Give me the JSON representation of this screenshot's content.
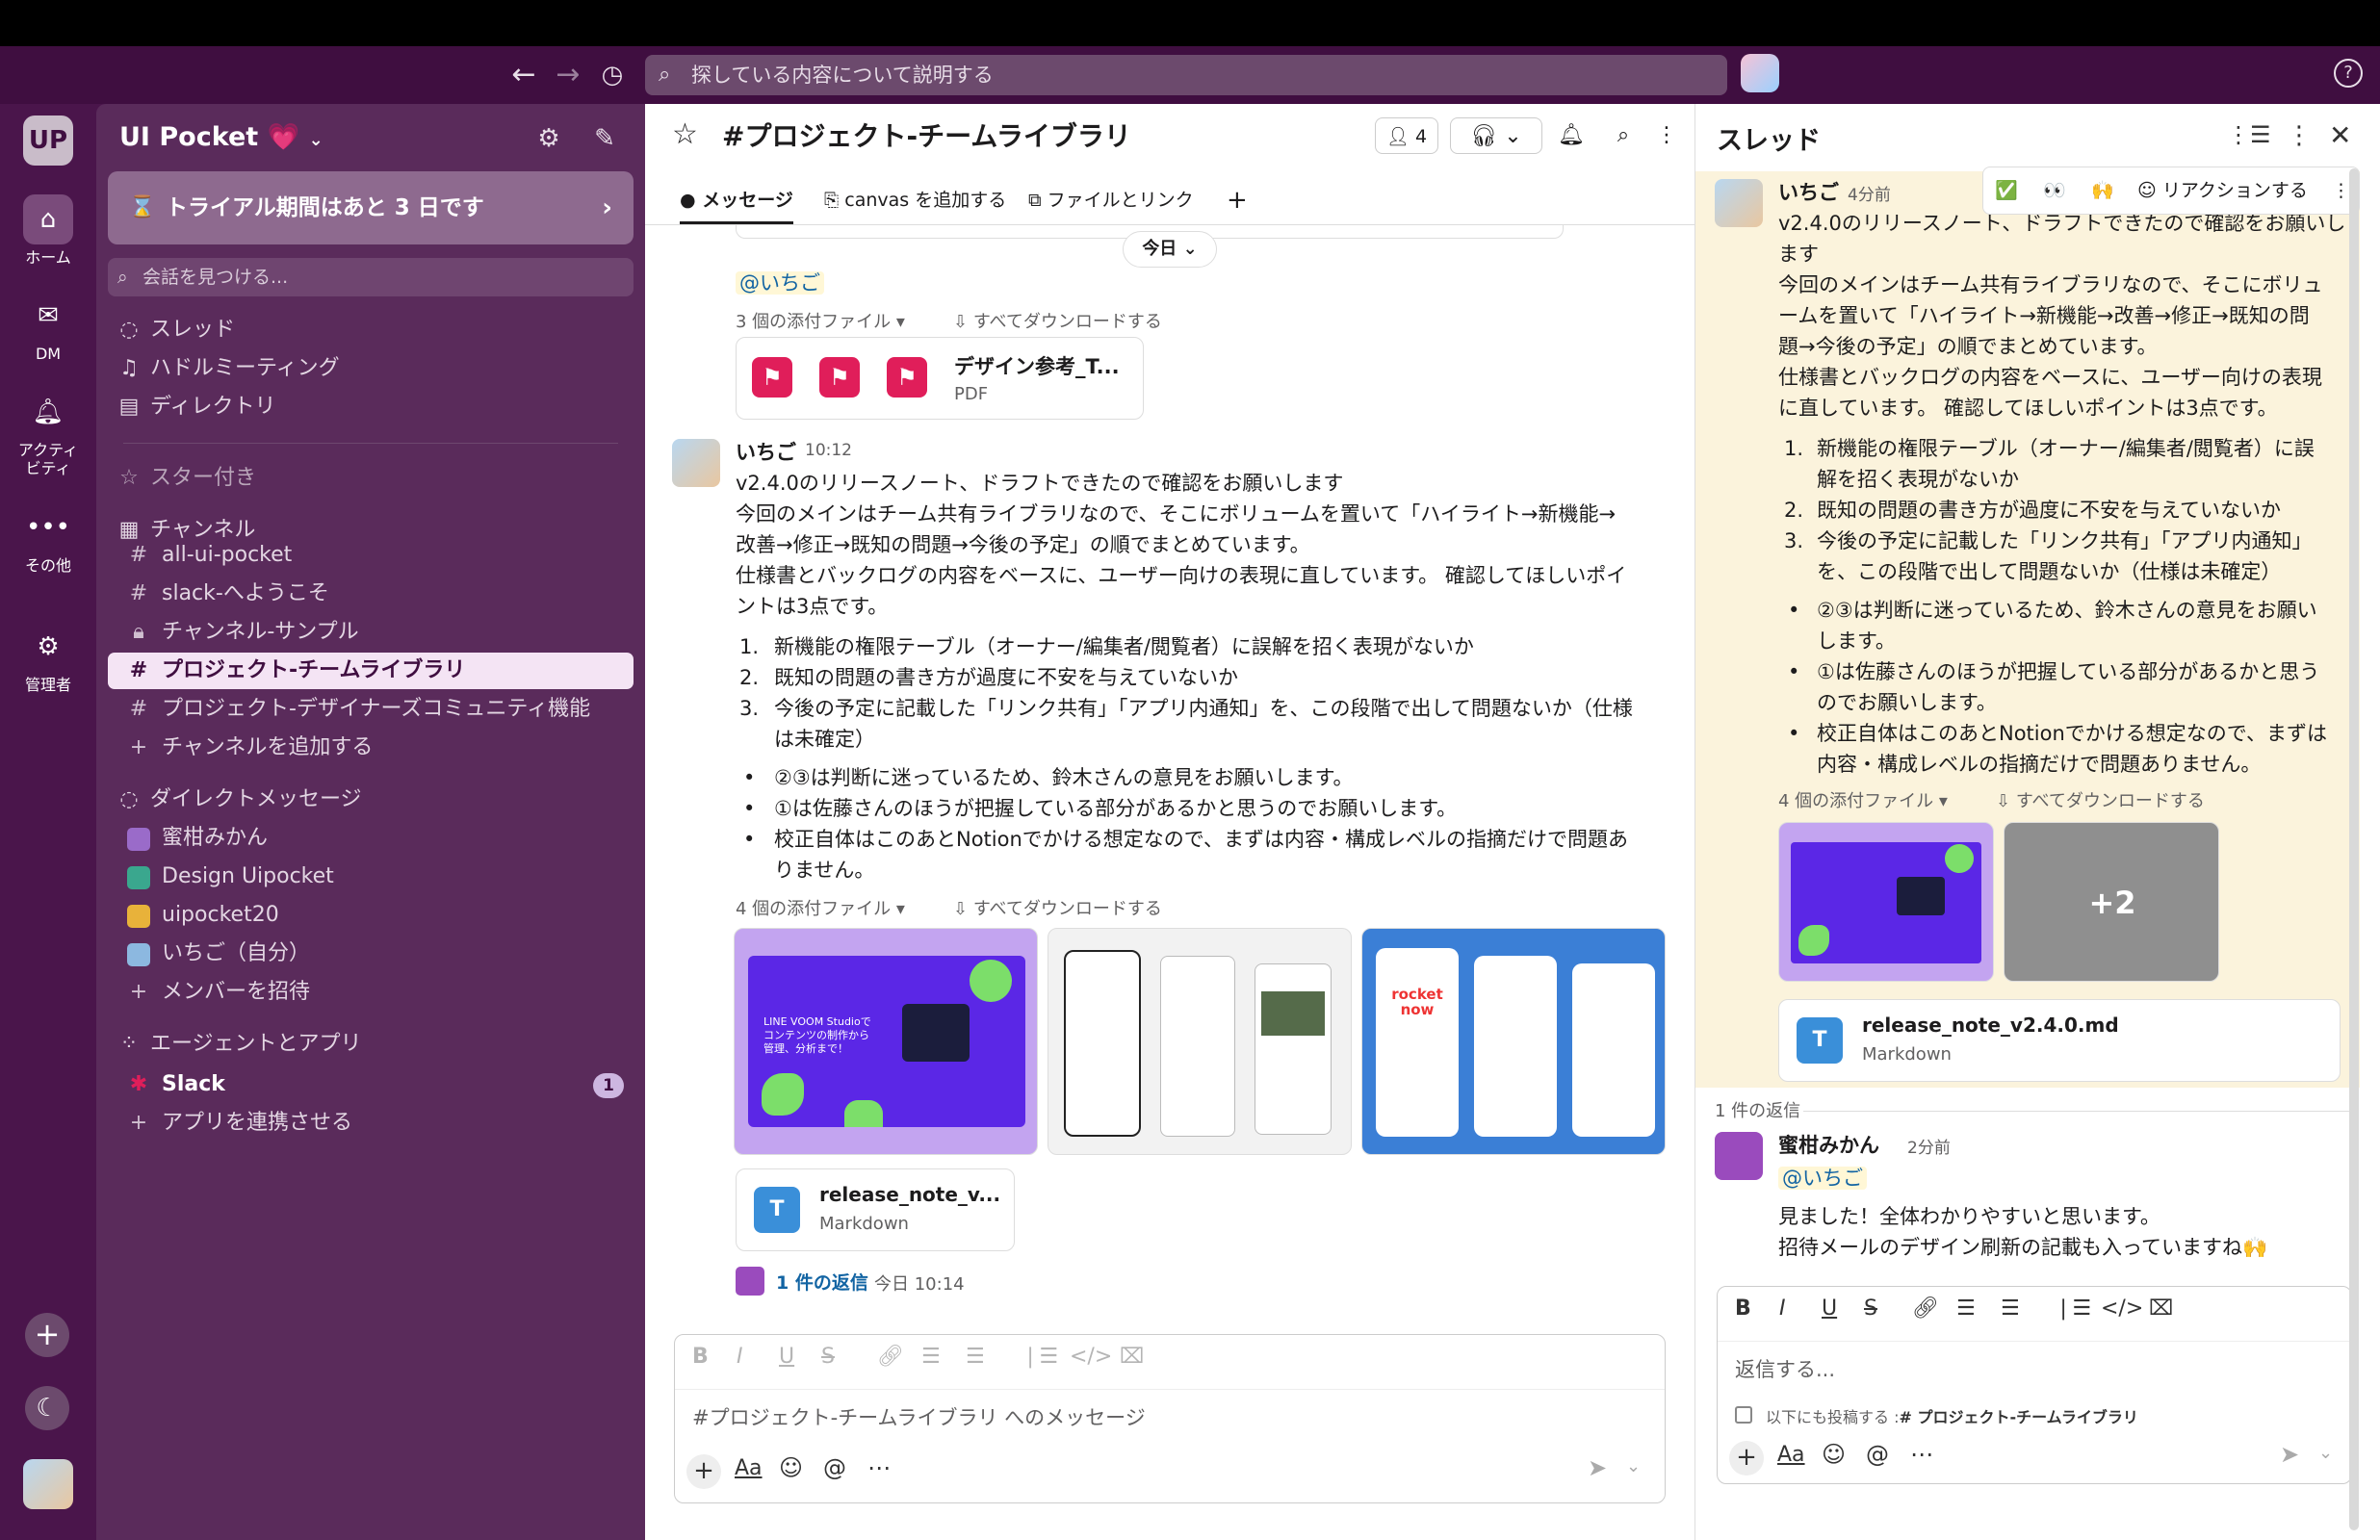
{
  "topbar": {
    "search_placeholder": "探している内容について説明する"
  },
  "rail": {
    "workspace": "UP",
    "home": "ホーム",
    "dm": "DM",
    "activity1": "アクティ",
    "activity2": "ビティ",
    "more": "その他",
    "admin": "管理者"
  },
  "sidebar": {
    "workspace_name": "UI Pocket 💗",
    "trial": "トライアル期間はあと 3 日です",
    "find": "会話を見つける...",
    "nav": [
      "スレッド",
      "ハドルミーティング",
      "ディレクトリ"
    ],
    "starred": "スター付き",
    "channels_header": "チャンネル",
    "channels": [
      "all-ui-pocket",
      "slack-へようこそ",
      "チャンネル-サンプル",
      "プロジェクト-チームライブラリ",
      "プロジェクト-デザイナーズコミュニティ機能"
    ],
    "add_channel": "チャンネルを追加する",
    "dm_header": "ダイレクトメッセージ",
    "dms": [
      "蜜柑みかん",
      "Design Uipocket",
      "uipocket20",
      "いちご（自分）"
    ],
    "invite": "メンバーを招待",
    "apps_header": "エージェントとアプリ",
    "slack": "Slack",
    "slack_badge": "1",
    "connect_app": "アプリを連携させる"
  },
  "channel": {
    "title": "#プロジェクト-チームライブラリ",
    "members": "4",
    "tabs": [
      "メッセージ",
      "canvas を追加する",
      "ファイルとリンク"
    ],
    "date_divider": "今日",
    "mention": "@いちご",
    "attach3": "3 個の添付ファイル",
    "download_all": "すべてダウンロードする",
    "pdf_name": "デザイン参考_T...",
    "pdf_type": "PDF",
    "author": "いちご",
    "time": "10:12",
    "para1": "v2.4.0のリリースノート、ドラフトできたので確認をお願いします",
    "para2a": "今回のメインはチーム共有ライブラリなので、そこにボリュームを置いて「ハイライト→新機能→",
    "para2b": "改善→修正→既知の問題→今後の予定」の順でまとめています。",
    "para3a": "仕様書とバックログの内容をベースに、ユーザー向けの表現に直しています。 確認してほしいポイ",
    "para3b": "ントは3点です。",
    "ol1": "新機能の権限テーブル（オーナー/編集者/閲覧者）に誤解を招く表現がないか",
    "ol2": "既知の問題の書き方が過度に不安を与えていないか",
    "ol3a": "今後の予定に記載した「リンク共有」「アプリ内通知」を、この段階で出して問題ないか（仕様",
    "ol3b": "は未確定）",
    "ul1": "②③は判断に迷っているため、鈴木さんの意見をお願いします。",
    "ul2": "①は佐藤さんのほうが把握している部分があるかと思うのでお願いします。",
    "ul3a": "校正自体はこのあとNotionでかける想定なので、まずは内容・構成レベルの指摘だけで問題あ",
    "ul3b": "りません。",
    "attach4": "4 個の添付ファイル",
    "img1_text": "LINE VOOM Studioでコンテンツの制作から管理、分析まで！",
    "img3_text": "rocket now",
    "md_name": "release_note_v...",
    "md_type": "Markdown",
    "reply_count": "1 件の返信",
    "reply_time": "今日 10:14",
    "composer_placeholder": "#プロジェクト-チームライブラリ へのメッセージ"
  },
  "thread": {
    "title": "スレッド",
    "react_label": "リアクションする",
    "author": "いちご",
    "time": "4分前",
    "l1": "v2.4.0のリリースノート、ドラフトできたので確認をお願いし",
    "l2": "ます",
    "l3": "今回のメインはチーム共有ライブラリなので、そこにボリュ",
    "l4": "ームを置いて「ハイライト→新機能→改善→修正→既知の問",
    "l5": "題→今後の予定」の順でまとめています。",
    "l6": "仕様書とバックログの内容をベースに、ユーザー向けの表現",
    "l7": "に直しています。 確認してほしいポイントは3点です。",
    "o1a": "新機能の権限テーブル（オーナー/編集者/閲覧者）に誤",
    "o1b": "解を招く表現がないか",
    "o2": "既知の問題の書き方が過度に不安を与えていないか",
    "o3a": "今後の予定に記載した「リンク共有」「アプリ内通知」",
    "o3b": "を、この段階で出して問題ないか（仕様は未確定）",
    "u1a": "②③は判断に迷っているため、鈴木さんの意見をお願い",
    "u1b": "します。",
    "u2a": "①は佐藤さんのほうが把握している部分があるかと思う",
    "u2b": "のでお願いします。",
    "u3a": "校正自体はこのあとNotionでかける想定なので、まずは",
    "u3b": "内容・構成レベルの指摘だけで問題ありません。",
    "attach4": "4 個の添付ファイル",
    "download_all": "すべてダウンロードする",
    "plus_more": "+2",
    "md_name": "release_note_v2.4.0.md",
    "md_type": "Markdown",
    "reply_count": "1 件の返信",
    "reply_author": "蜜柑みかん",
    "reply_time": "2分前",
    "reply_mention": "@いちご",
    "reply1": "見ました！全体わかりやすいと思います。",
    "reply2": "招待メールのデザイン刷新の記載も入っていますね🙌",
    "composer_placeholder": "返信する...",
    "also_post": "以下にも投稿する :",
    "also_channel": "# プロジェクト-チームライブラリ"
  }
}
